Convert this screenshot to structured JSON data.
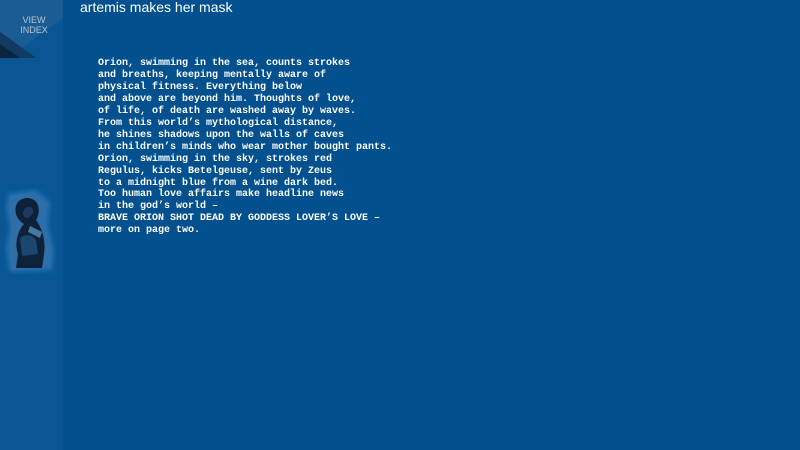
{
  "nav": {
    "view_index_label": "VIEW\nINDEX",
    "thumbnail_icon": "figure-thumbnail-icon"
  },
  "header": {
    "title": "artemis makes her mask"
  },
  "poem": {
    "lines": [
      "Orion, swimming in the sea, counts strokes",
      "and breaths, keeping mentally aware of",
      "physical fitness. Everything below",
      "and above are beyond him. Thoughts of love,",
      "of life, of death are washed away by waves.",
      "From this world’s mythological distance,",
      "he shines shadows upon the walls of caves",
      "in children’s minds who wear mother bought pants.",
      "Orion, swimming in the sky, strokes red",
      "Regulus, kicks Betelgeuse, sent by Zeus",
      "to a midnight blue from a wine dark bed.",
      "Too human love affairs make headline news",
      "in the god’s world –",
      "BRAVE ORION SHOT DEAD BY GODDESS LOVER’S LOVE –",
      "more on page two."
    ]
  },
  "colors": {
    "background": "#03508f",
    "nav_panel": "#0a5694",
    "text": "#ffffff",
    "view_index_text": "#b9c3cc"
  }
}
